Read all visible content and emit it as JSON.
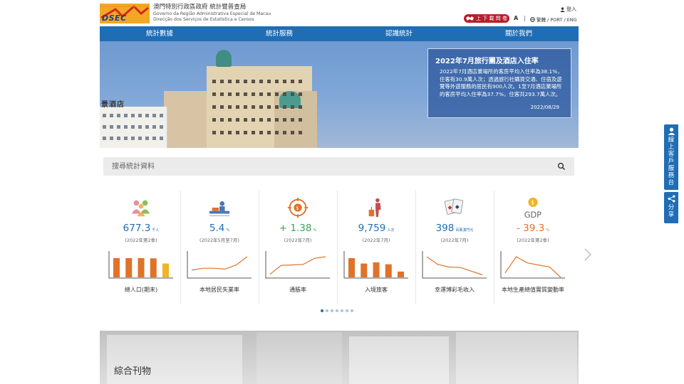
{
  "header": {
    "logo_text": "DSEC",
    "org_name_zh": "澳門特別行政區政府 統計暨普查局",
    "org_name_pt1": "Governo da Região Administrativa Especial de Macau",
    "org_name_pt2": "Direcção dos Serviços de Estatística e Censos",
    "login_label": "登入",
    "survey_button": "上 下 載 問 卷",
    "font_size_button": "A",
    "language_links": "繁體 / PORT / ENG"
  },
  "nav": {
    "items": [
      {
        "label": "統計數據"
      },
      {
        "label": "統計服務"
      },
      {
        "label": "認識統計"
      },
      {
        "label": "關於我們"
      }
    ]
  },
  "banner": {
    "shop_sign": "景酒店",
    "title": "2022年7月旅行團及酒店入住率",
    "body": "2022年7月酒店業場所的客房平均入住率為38.1%，住客有30.9萬人次；透過旅行社購買交通、住宿及遊覽等外遊服務的居民有900人次。1至7月酒店業場所的客房平均入住率為37.7%，住客共293.7萬人次。",
    "date": "2022/08/29",
    "slide_count": 9,
    "active_slide": 4
  },
  "search": {
    "placeholder": "搜尋統計資料",
    "icon": "search-icon"
  },
  "stats": [
    {
      "value": "677.3",
      "unit": "千人",
      "period": "(2022年第2季)",
      "label": "總人口(期末)",
      "color": "#1f6db5",
      "chart": "bar",
      "icon": "population-icon",
      "series": [
        1.0,
        1.0,
        1.0,
        0.99,
        0.72
      ]
    },
    {
      "value": "5.4",
      "unit": "%",
      "period": "(2022年5月至7月)",
      "label": "本地居民失業率",
      "color": "#1f6db5",
      "chart": "line",
      "icon": "unemployment-icon",
      "series": [
        0.35,
        0.44,
        0.44,
        0.4,
        0.6,
        1.0
      ]
    },
    {
      "value": "+ 1.38",
      "unit": "%",
      "period": "(2022年7月)",
      "label": "通脹率",
      "color": "#3ea45a",
      "chart": "line",
      "icon": "inflation-icon",
      "series": [
        0.15,
        0.58,
        0.6,
        0.63,
        0.92,
        1.0
      ]
    },
    {
      "value": "9,759",
      "unit": "人次",
      "period": "(2022年7月)",
      "label": "入境旅客",
      "color": "#1f6db5",
      "chart": "bar",
      "icon": "visitor-icon",
      "series": [
        1.0,
        0.72,
        0.78,
        0.68,
        0.3
      ]
    },
    {
      "value": "398",
      "unit": "百萬澳門元",
      "period": "(2022年7月)",
      "label": "幸運博彩毛收入",
      "color": "#1f6db5",
      "chart": "line",
      "icon": "gaming-icon",
      "series": [
        1.0,
        0.62,
        0.5,
        0.48,
        0.3,
        0.12
      ]
    },
    {
      "value": "- 39.3",
      "unit": "%",
      "period": "(2022年第2季)",
      "label": "本地生產總值實質變動率",
      "color": "#e0722a",
      "chart": "line",
      "icon": "gdp-icon",
      "series": [
        0.22,
        1.0,
        0.7,
        0.6,
        0.5,
        0.0
      ]
    }
  ],
  "stats_pager": {
    "count": 7,
    "active": 0
  },
  "publications": {
    "title": "綜合刊物"
  },
  "side": {
    "service_label": "線上客戶服務台",
    "share_label": "分享"
  },
  "colors": {
    "primary": "#1f6db5",
    "survey_red": "#b61e2b",
    "chart_orange": "#e0722a",
    "positive_green": "#3ea45a"
  }
}
